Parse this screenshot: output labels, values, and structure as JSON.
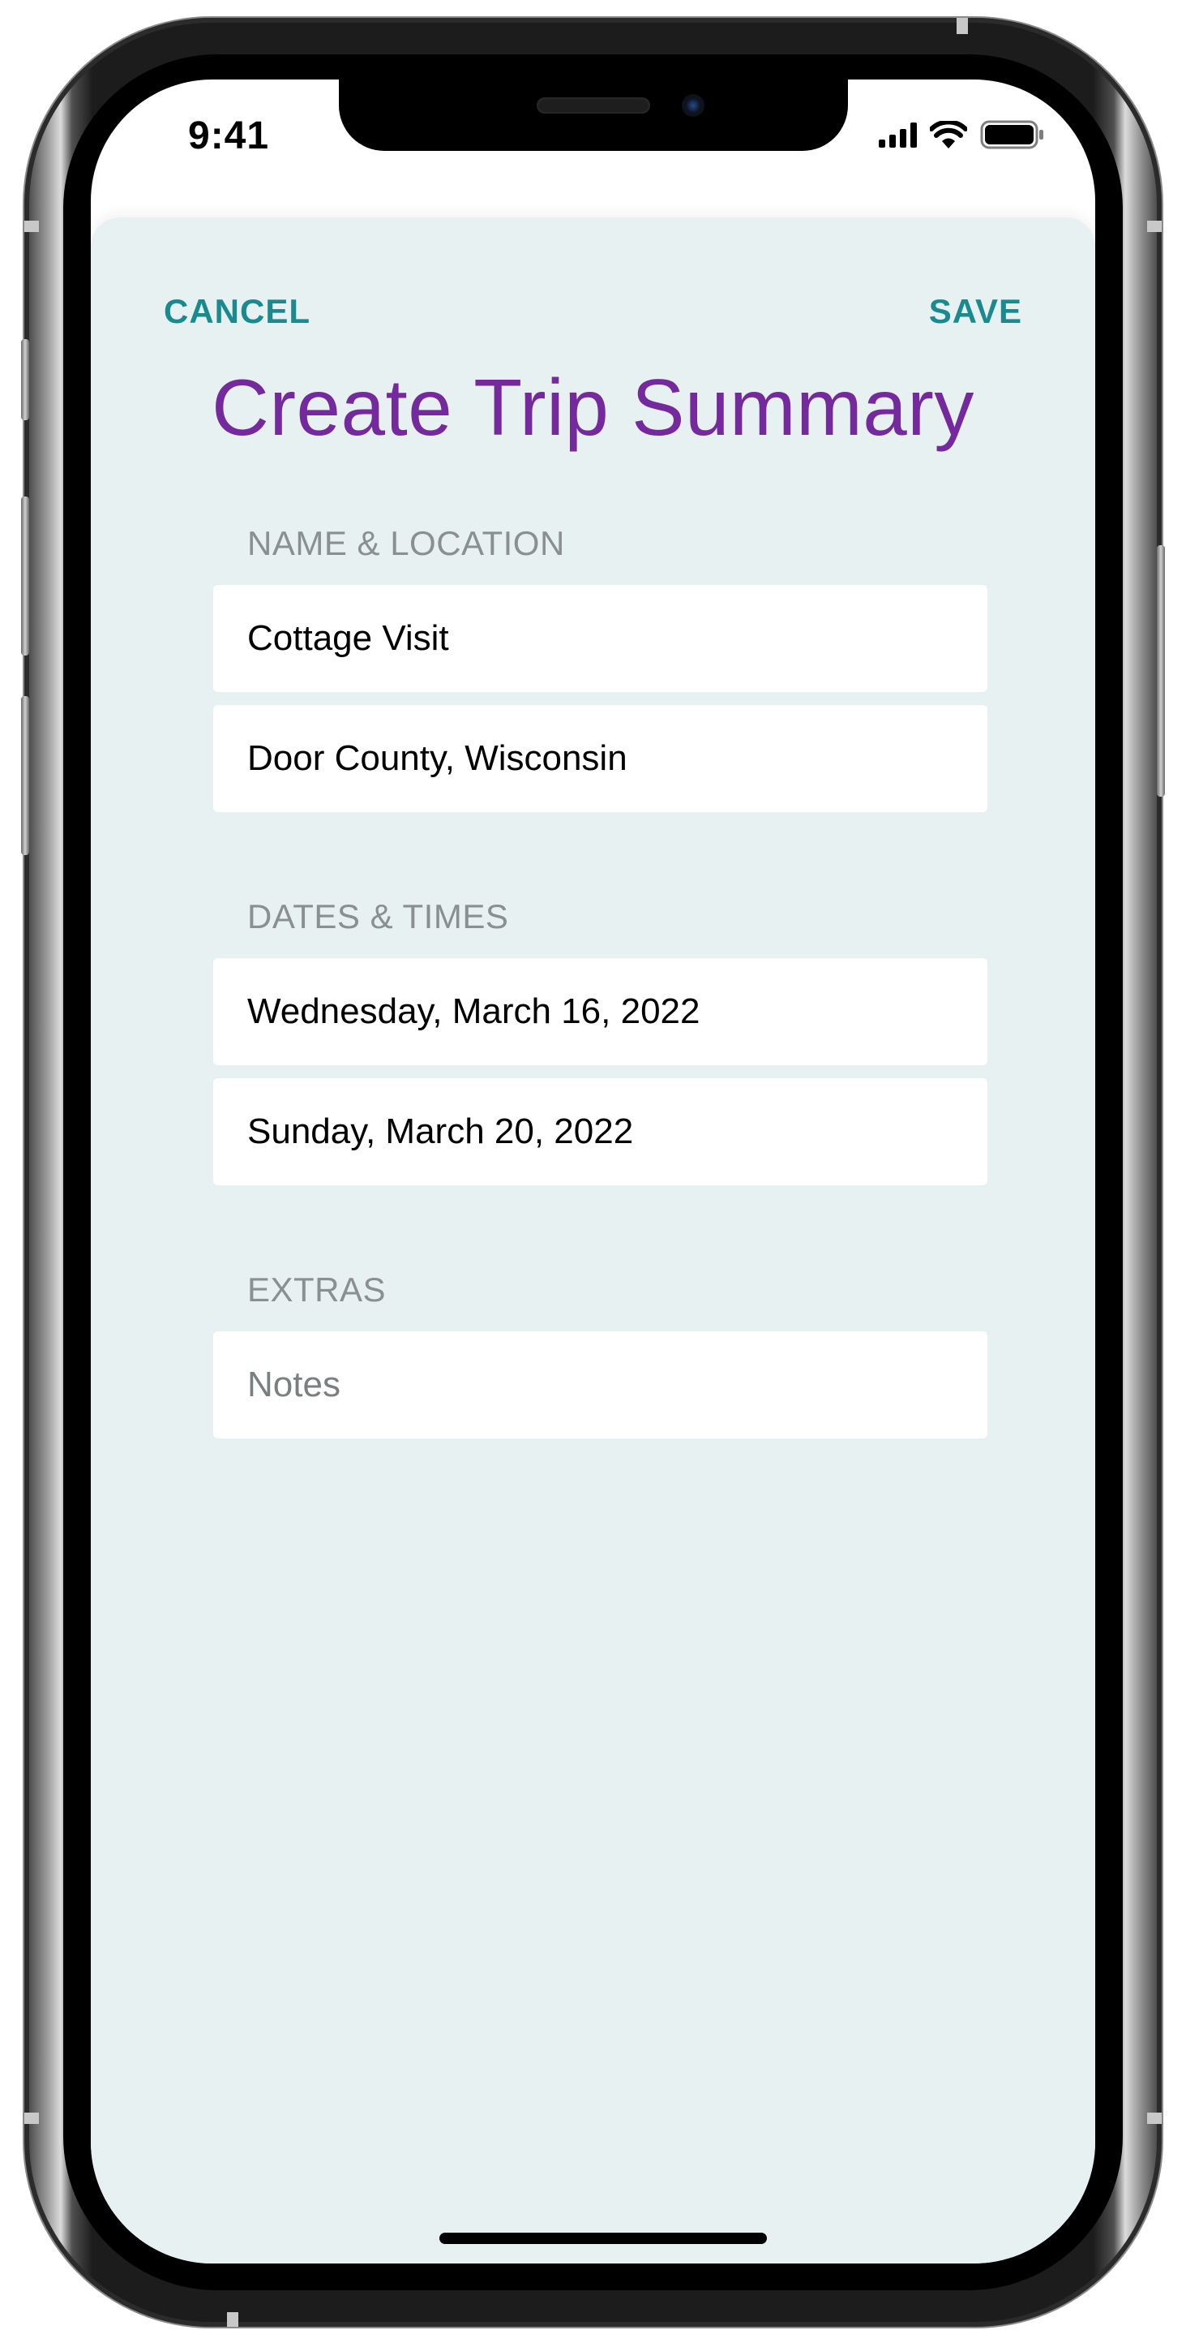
{
  "status_bar": {
    "time": "9:41",
    "icons": [
      "cellular-signal-icon",
      "wifi-icon",
      "battery-icon"
    ]
  },
  "nav": {
    "cancel_label": "CANCEL",
    "save_label": "SAVE"
  },
  "title": "Create Trip Summary",
  "sections": {
    "name_location": {
      "label": "NAME & LOCATION",
      "name_value": "Cottage Visit",
      "location_value": "Door County, Wisconsin"
    },
    "dates_times": {
      "label": "DATES & TIMES",
      "start_date": "Wednesday, March 16, 2022",
      "end_date": "Sunday, March 20, 2022"
    },
    "extras": {
      "label": "EXTRAS",
      "notes_placeholder": "Notes"
    }
  },
  "colors": {
    "accent": "#1a8a8e",
    "title": "#742a9c",
    "sheet_background": "#e8f1f1",
    "section_label": "#8a8f91"
  }
}
